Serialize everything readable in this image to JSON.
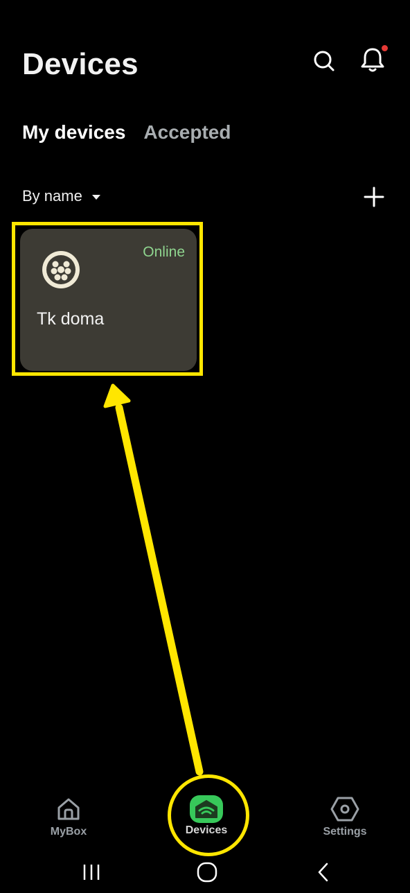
{
  "header": {
    "title": "Devices",
    "icons": [
      "search-icon",
      "bell-icon"
    ],
    "notification_dot_color": "#e53935"
  },
  "tabs": [
    {
      "label": "My devices",
      "active": true
    },
    {
      "label": "Accepted",
      "active": false
    }
  ],
  "toolbar": {
    "sort_label": "By name",
    "sort_icon": "caret-down-icon",
    "add_icon": "plus-icon"
  },
  "devices": [
    {
      "name": "Tk doma",
      "status": "Online",
      "status_color": "#8fd58f",
      "icon": "ev-charger-plug-icon"
    }
  ],
  "bottom_nav": {
    "items": [
      {
        "label": "MyBox",
        "icon": "home-icon",
        "active": false
      },
      {
        "label": "Devices",
        "icon": "wifi-house-icon",
        "active": true
      },
      {
        "label": "Settings",
        "icon": "settings-hexagon-icon",
        "active": false
      }
    ],
    "active_color": "#37c85a"
  },
  "system_nav": [
    "recents-icon",
    "home-circle-icon",
    "back-chevron-icon"
  ],
  "annotation": {
    "color": "#ffe600"
  }
}
